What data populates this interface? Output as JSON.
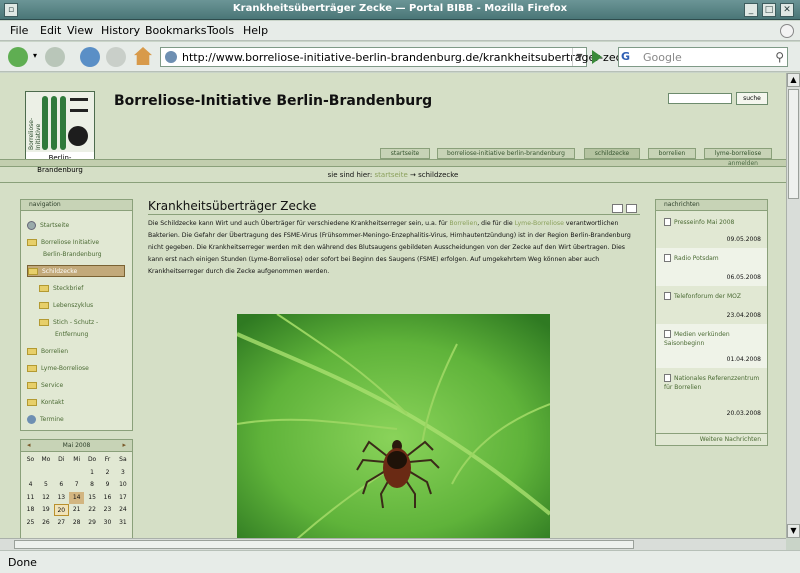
{
  "window": {
    "title": "Krankheitsüberträger Zecke — Portal BIBB - Mozilla Firefox"
  },
  "menubar": {
    "items": [
      "File",
      "Edit",
      "View",
      "History",
      "Bookmarks",
      "Tools",
      "Help"
    ]
  },
  "navbar": {
    "url": "http://www.borreliose-initiative-berlin-brandenburg.de/krankheitsubertrager-zecke",
    "search_placeholder": "Google",
    "search_engine_letter": "G"
  },
  "site": {
    "title": "Borreliose-Initiative Berlin-Brandenburg",
    "logo_vertical": "Borreliose-Initiative",
    "logo_caption": "Berlin-Brandenburg",
    "search_button": "suche",
    "tabs": [
      "startseite",
      "borreliose-initiative berlin-brandenburg",
      "schildzecke",
      "borrelien",
      "lyme-borreliose"
    ],
    "login": "anmelden",
    "breadcrumb_prefix": "sie sind hier:",
    "breadcrumb_home": "startseite",
    "breadcrumb_sep": "→",
    "breadcrumb_current": "schildzecke"
  },
  "nav": {
    "heading": "navigation",
    "items": [
      {
        "label": "Startseite"
      },
      {
        "label": "Borreliose Initiative"
      },
      {
        "label": "Berlin-Brandenburg"
      },
      {
        "label": "Schildzecke"
      },
      {
        "label": "Steckbrief"
      },
      {
        "label": "Lebenszyklus"
      },
      {
        "label": "Stich - Schutz -"
      },
      {
        "label": "Entfernung"
      },
      {
        "label": "Borrelien"
      },
      {
        "label": "Lyme-Borreliose"
      },
      {
        "label": "Service"
      },
      {
        "label": "Kontakt"
      },
      {
        "label": "Termine"
      }
    ]
  },
  "calendar": {
    "month": "Mai 2008",
    "weekdays": [
      "So",
      "Mo",
      "Di",
      "Mi",
      "Do",
      "Fr",
      "Sa"
    ],
    "weeks": [
      [
        "",
        "",
        "",
        "",
        "1",
        "2",
        "3"
      ],
      [
        "4",
        "5",
        "6",
        "7",
        "8",
        "9",
        "10"
      ],
      [
        "11",
        "12",
        "13",
        "14",
        "15",
        "16",
        "17"
      ],
      [
        "18",
        "19",
        "20",
        "21",
        "22",
        "23",
        "24"
      ],
      [
        "25",
        "26",
        "27",
        "28",
        "29",
        "30",
        "31"
      ]
    ]
  },
  "content": {
    "title": "Krankheitsüberträger Zecke",
    "p1": "Die Schildzecke kann Wirt und auch Überträger für verschiedene Krankheitserreger sein, u.a. für ",
    "link1": "Borrelien",
    "p2": ", die für die ",
    "link2": "Lyme-Borreliose",
    "p3": " verantwortlichen Bakterien. Die Gefahr der Übertragung des FSME-Virus (Frühsommer-Meningo-Enzephalitis-Virus, Hirnhautentzündung) ist in der Region Berlin-Brandenburg nicht gegeben. Die Krankheitserreger werden mit den während des Blutsaugens gebildeten Ausscheidungen von der Zecke auf den Wirt übertragen. Dies kann erst nach einigen Stunden (Lyme-Borreliose) oder sofort bei Beginn des Saugens (FSME) erfolgen. Auf umgekehrtem Weg können aber auch Krankheitserreger durch die Zecke aufgenommen werden."
  },
  "news": {
    "heading": "nachrichten",
    "items": [
      {
        "title": "Presseinfo Mai 2008",
        "date": "09.05.2008"
      },
      {
        "title": "Radio Potsdam",
        "date": "06.05.2008"
      },
      {
        "title": "Telefonforum der MOZ",
        "date": "23.04.2008"
      },
      {
        "title": "Medien verkünden Saisonbeginn",
        "date": "01.04.2008"
      },
      {
        "title": "Nationales Referenzzentrum für Borrelien",
        "date": "20.03.2008"
      }
    ],
    "more": "Weitere Nachrichten"
  },
  "status": {
    "text": "Done"
  },
  "colors": {
    "page_bg": "#d5dfc6",
    "link": "#8aa05b",
    "active_nav": "#c2a97a"
  }
}
